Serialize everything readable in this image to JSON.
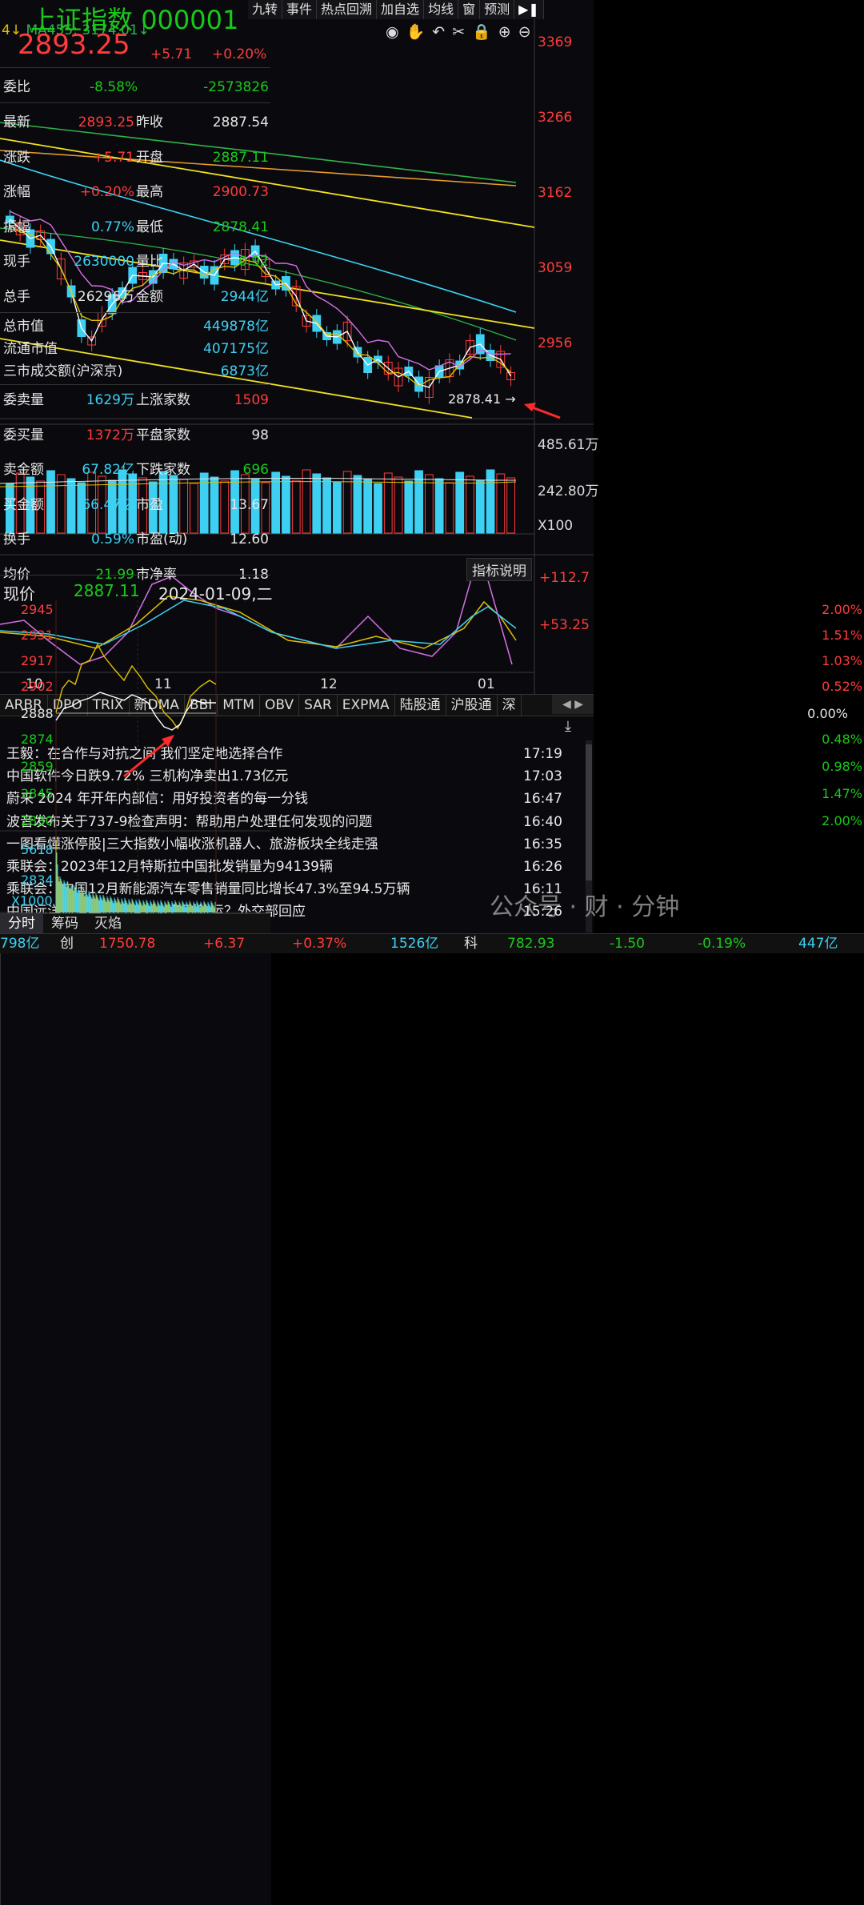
{
  "toolbar": {
    "items": [
      "九转",
      "事件",
      "热点回溯",
      "加自选",
      "均线",
      "窗",
      "预测"
    ]
  },
  "ma_label": {
    "prefix": "4↓",
    "text": "MA455: 3174.01↓"
  },
  "price_axis": [
    "3369",
    "3266",
    "3162",
    "3059",
    "2956"
  ],
  "low_marker": "2878.41",
  "volume_axis": [
    "485.61万",
    "242.80万",
    "X100"
  ],
  "indicator": {
    "button": "指标说明",
    "axis": [
      "+112.7",
      "+53.25"
    ]
  },
  "months": [
    "10",
    "11",
    "12",
    "01"
  ],
  "tabs": [
    "ARBR",
    "DPO",
    "TRIX",
    "新DMA",
    "BBI",
    "MTM",
    "OBV",
    "SAR",
    "EXPMA",
    "陆股通",
    "沪股通",
    "深"
  ],
  "news": [
    {
      "title": "王毅：在合作与对抗之间 我们坚定地选择合作",
      "time": "17:19"
    },
    {
      "title": "中国软件今日跌9.72% 三机构净卖出1.73亿元",
      "time": "17:03"
    },
    {
      "title": "蔚来 2024 年开年内部信：用好投资者的每一分钱",
      "time": "16:47"
    },
    {
      "title": "波音发布关于737-9检查声明：帮助用户处理任何发现的问题",
      "time": "16:40"
    },
    {
      "title": "一图看懂涨停股|三大指数小幅收涨机器人、旅游板块全线走强",
      "time": "16:35"
    },
    {
      "title": "乘联会：2023年12月特斯拉中国批发销量为94139辆",
      "time": "16:26"
    },
    {
      "title": "乘联会：中国12月新能源汽车零售销量同比增长47.3%至94.5万辆",
      "time": "16:11"
    },
    {
      "title": "中国远洋海运集团暂停对以色列航运？外交部回应",
      "time": "15:26"
    }
  ],
  "quote": {
    "name": "上证指数",
    "code": "000001",
    "price": "2893.25",
    "change": "+5.71",
    "pct": "+0.20%",
    "weibi": {
      "label": "委比",
      "pct": "-8.58%",
      "diff": "-2573826"
    },
    "rows": [
      {
        "l1": "最新",
        "v1": "2893.25",
        "c1": "red",
        "l2": "昨收",
        "v2": "2887.54",
        "c2": "wht"
      },
      {
        "l1": "涨跌",
        "v1": "+5.71",
        "c1": "red",
        "l2": "开盘",
        "v2": "2887.11",
        "c2": "grn"
      },
      {
        "l1": "涨幅",
        "v1": "+0.20%",
        "c1": "red",
        "l2": "最高",
        "v2": "2900.73",
        "c2": "red"
      },
      {
        "l1": "振幅",
        "v1": "0.77%",
        "c1": "cyan",
        "l2": "最低",
        "v2": "2878.41",
        "c2": "grn"
      },
      {
        "l1": "现手",
        "v1": "2630000",
        "c1": "cyan",
        "l2": "量比",
        "v2": "0.92",
        "c2": "grn"
      },
      {
        "l1": "总手",
        "v1": "26296万",
        "c1": "wht",
        "l2": "金额",
        "v2": "2944亿",
        "c2": "cyan"
      }
    ],
    "mkt": [
      {
        "label": "总市值",
        "value": "449878亿"
      },
      {
        "label": "流通市值",
        "value": "407175亿"
      },
      {
        "label": "三市成交额(沪深京)",
        "value": "6873亿"
      }
    ],
    "rows2": [
      {
        "l1": "委卖量",
        "v1": "1629万",
        "c1": "cyan",
        "l2": "上涨家数",
        "v2": "1509",
        "c2": "red"
      },
      {
        "l1": "委买量",
        "v1": "1372万",
        "c1": "red",
        "l2": "平盘家数",
        "v2": "98",
        "c2": "wht"
      },
      {
        "l1": "卖金额",
        "v1": "67.82亿",
        "c1": "cyan",
        "l2": "下跌家数",
        "v2": "696",
        "c2": "grn"
      },
      {
        "l1": "买金额",
        "v1": "66.47亿",
        "c1": "cyan",
        "l2": "市盈",
        "v2": "13.67",
        "c2": "wht"
      },
      {
        "l1": "换手",
        "v1": "0.59%",
        "c1": "cyan",
        "l2": "市盈(动)",
        "v2": "12.60",
        "c2": "wht"
      },
      {
        "l1": "均价",
        "v1": "21.99",
        "c1": "grn",
        "l2": "市净率",
        "v2": "1.18",
        "c2": "wht"
      }
    ]
  },
  "intraday": {
    "label": "现价",
    "price": "2887.11",
    "date": "2024-01-09,二",
    "left_axis_up": [
      "2945",
      "2931",
      "2917",
      "2902"
    ],
    "mid": "2888",
    "left_axis_dn": [
      "2874",
      "2859",
      "2845",
      "2830"
    ],
    "right_axis_up": [
      "2.00%",
      "1.51%",
      "1.03%",
      "0.52%"
    ],
    "mid_pct": "0.00%",
    "right_axis_dn": [
      "0.48%",
      "0.98%",
      "1.47%",
      "2.00%"
    ],
    "vol_axis": [
      "5618",
      "2834",
      "X1000"
    ],
    "tabs": [
      "分时",
      "筹码",
      "灭焰"
    ]
  },
  "watermark": "公众号 · 财 · 分钟",
  "bottom": {
    "left_val": "798亿",
    "label": "创",
    "index": "1750.78",
    "chg": "+6.37",
    "pct": "+0.37%",
    "amt": "1526亿",
    "label2": "科",
    "index2": "782.93",
    "chg2": "-1.50",
    "pct2": "-0.19%",
    "amt2": "447亿"
  }
}
